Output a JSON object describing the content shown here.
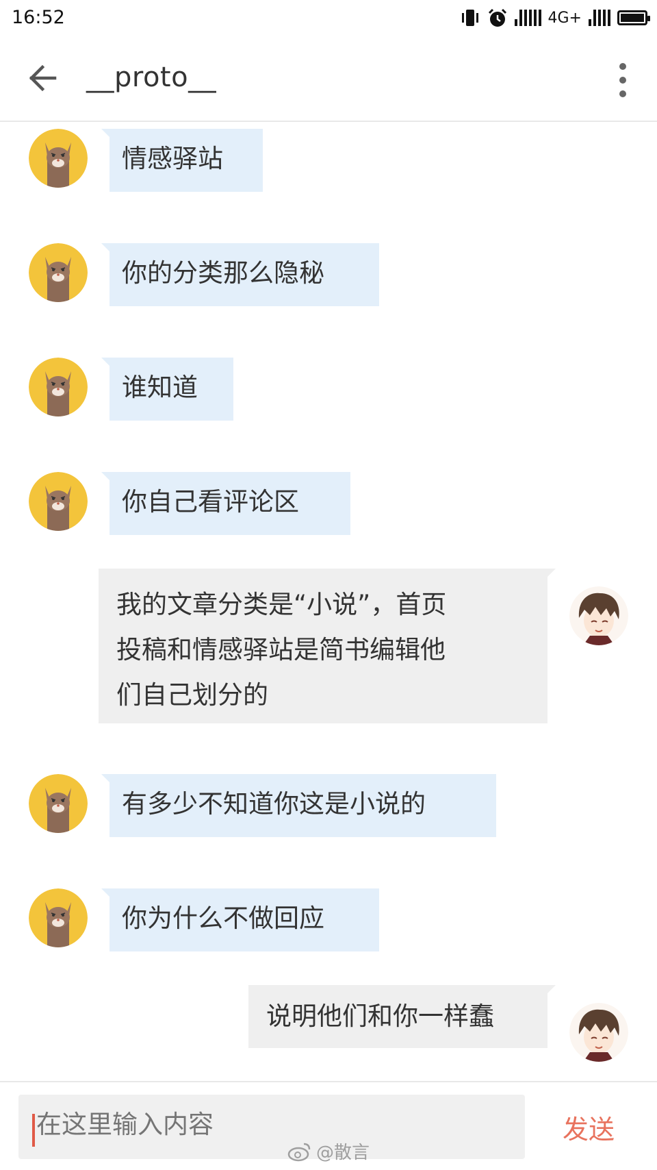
{
  "status_bar": {
    "time": "16:52",
    "network": "4G+"
  },
  "header": {
    "title": "__proto__"
  },
  "messages": [
    {
      "side": "left",
      "text": "情感驿站"
    },
    {
      "side": "left",
      "text": "你的分类那么隐秘"
    },
    {
      "side": "left",
      "text": "谁知道"
    },
    {
      "side": "left",
      "text": "你自己看评论区"
    },
    {
      "side": "right",
      "lines": [
        "我的文章分类是“小说”，首页",
        "投稿和情感驿站是简书编辑他",
        "们自己划分的"
      ]
    },
    {
      "side": "left",
      "text": "有多少不知道你这是小说的"
    },
    {
      "side": "left",
      "text": "你为什么不做回应"
    },
    {
      "side": "right",
      "text": "说明他们和你一样蠢"
    }
  ],
  "input": {
    "placeholder": "在这里输入内容",
    "send_label": "发送"
  },
  "watermark": "@散言",
  "colors": {
    "left_bubble": "#e3effa",
    "right_bubble": "#efefef",
    "send": "#e8735e"
  }
}
